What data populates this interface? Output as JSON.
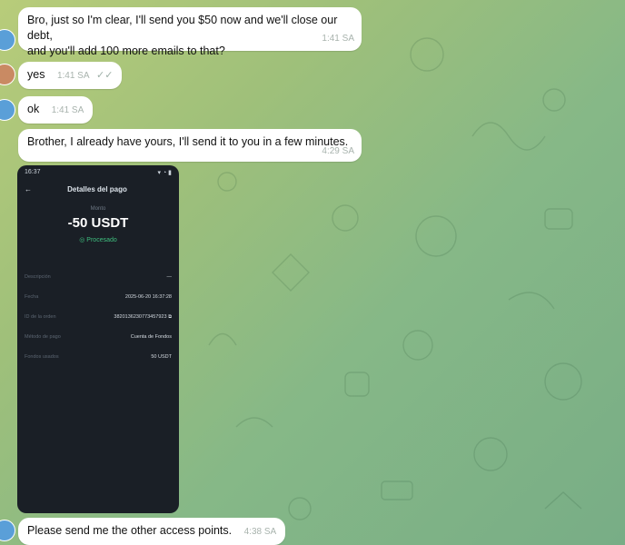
{
  "messages": [
    {
      "text": "Bro, just so I'm clear, I'll send you $50 now and we'll close our debt,\nand you'll add 100 more emails to that?",
      "time": "1:41 SA"
    },
    {
      "text": "yes",
      "time": "1:41 SA",
      "check": "✓✓"
    },
    {
      "text": "ok",
      "time": "1:41 SA"
    },
    {
      "text": "Brother, I already have yours, I'll send it to you in a few minutes.",
      "time": "4:29 SA"
    },
    {
      "text": "Please send me the other access points.",
      "time": "4:38 SA"
    }
  ],
  "photo": {
    "status_time": "16:37",
    "status_icons": "▾ ◔ ▮",
    "back": "←",
    "title": "Detalles del pago",
    "amount_caption": "Monto",
    "amount": "-50 USDT",
    "state": "Procesado",
    "rows": [
      {
        "label": "Descripción",
        "value": "—"
      },
      {
        "label": "Fecha",
        "value": "2025-06-20 16:37:28"
      },
      {
        "label": "ID de la orden",
        "value": "3820136230773457923"
      },
      {
        "label": "Método de pago",
        "value": "Cuenta de Fondos"
      },
      {
        "label": "Fondos usados",
        "value": "50 USDT"
      }
    ]
  },
  "colors": {
    "bubble": "#ffffff",
    "success": "#3fbf7f",
    "photo_bg": "#1a1f26"
  }
}
